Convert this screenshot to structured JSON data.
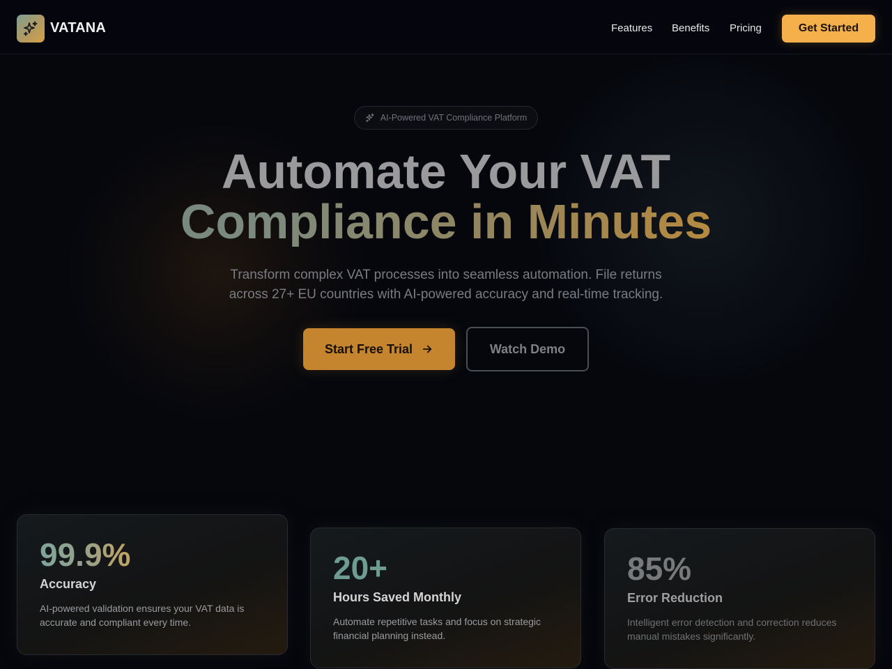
{
  "brand": {
    "name": "VATANA",
    "logo_icon": "sparkles-icon"
  },
  "nav": {
    "links": [
      "Features",
      "Benefits",
      "Pricing"
    ],
    "cta": "Get Started"
  },
  "hero": {
    "badge": "AI-Powered VAT Compliance Platform",
    "badge_icon": "sparkles-icon",
    "title_line1": "Automate Your VAT",
    "title_line2": "Compliance in Minutes",
    "subtitle_line1": "Transform complex VAT processes into seamless automation. File returns",
    "subtitle_line2": "across 27+ EU countries with AI-powered accuracy and real-time tracking.",
    "primary_button": "Start Free Trial",
    "primary_button_icon": "arrow-right-icon",
    "secondary_button": "Watch Demo"
  },
  "stats": [
    {
      "value": "99.9%",
      "title": "Accuracy",
      "description": "AI-powered validation ensures your VAT data is accurate and compliant every time."
    },
    {
      "value": "20+",
      "title": "Hours Saved Monthly",
      "description": "Automate repetitive tasks and focus on strategic financial planning instead."
    },
    {
      "value": "85%",
      "title": "Error Reduction",
      "description": "Intelligent error detection and correction reduces manual mistakes significantly."
    }
  ],
  "colors": {
    "accent": "#f6b04b",
    "primary_button": "#c5852e",
    "background": "#05070d"
  }
}
